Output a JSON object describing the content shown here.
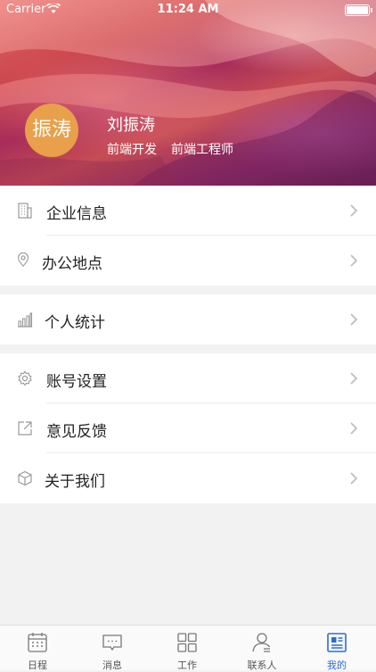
{
  "status_bar": {
    "carrier": "Carrier",
    "time": "11:24 AM"
  },
  "profile": {
    "avatar_text": "振涛",
    "name": "刘振涛",
    "department": "前端开发",
    "title": "前端工程师"
  },
  "menu": {
    "group1": [
      {
        "label": "企业信息",
        "icon": "building-icon"
      },
      {
        "label": "办公地点",
        "icon": "location-pin-icon"
      }
    ],
    "group2": [
      {
        "label": "个人统计",
        "icon": "bar-chart-icon"
      }
    ],
    "group3": [
      {
        "label": "账号设置",
        "icon": "gear-icon"
      },
      {
        "label": "意见反馈",
        "icon": "share-arrow-icon"
      },
      {
        "label": "关于我们",
        "icon": "cube-icon"
      }
    ]
  },
  "tabbar": {
    "active": "我的",
    "tabs": [
      {
        "label": "日程",
        "icon": "calendar-icon"
      },
      {
        "label": "消息",
        "icon": "message-icon"
      },
      {
        "label": "工作",
        "icon": "grid-icon"
      },
      {
        "label": "联系人",
        "icon": "contact-icon"
      },
      {
        "label": "我的",
        "icon": "profile-doc-icon"
      }
    ]
  },
  "colors": {
    "accent": "#2a6cd6",
    "avatar_bg": "#e8a04a"
  }
}
